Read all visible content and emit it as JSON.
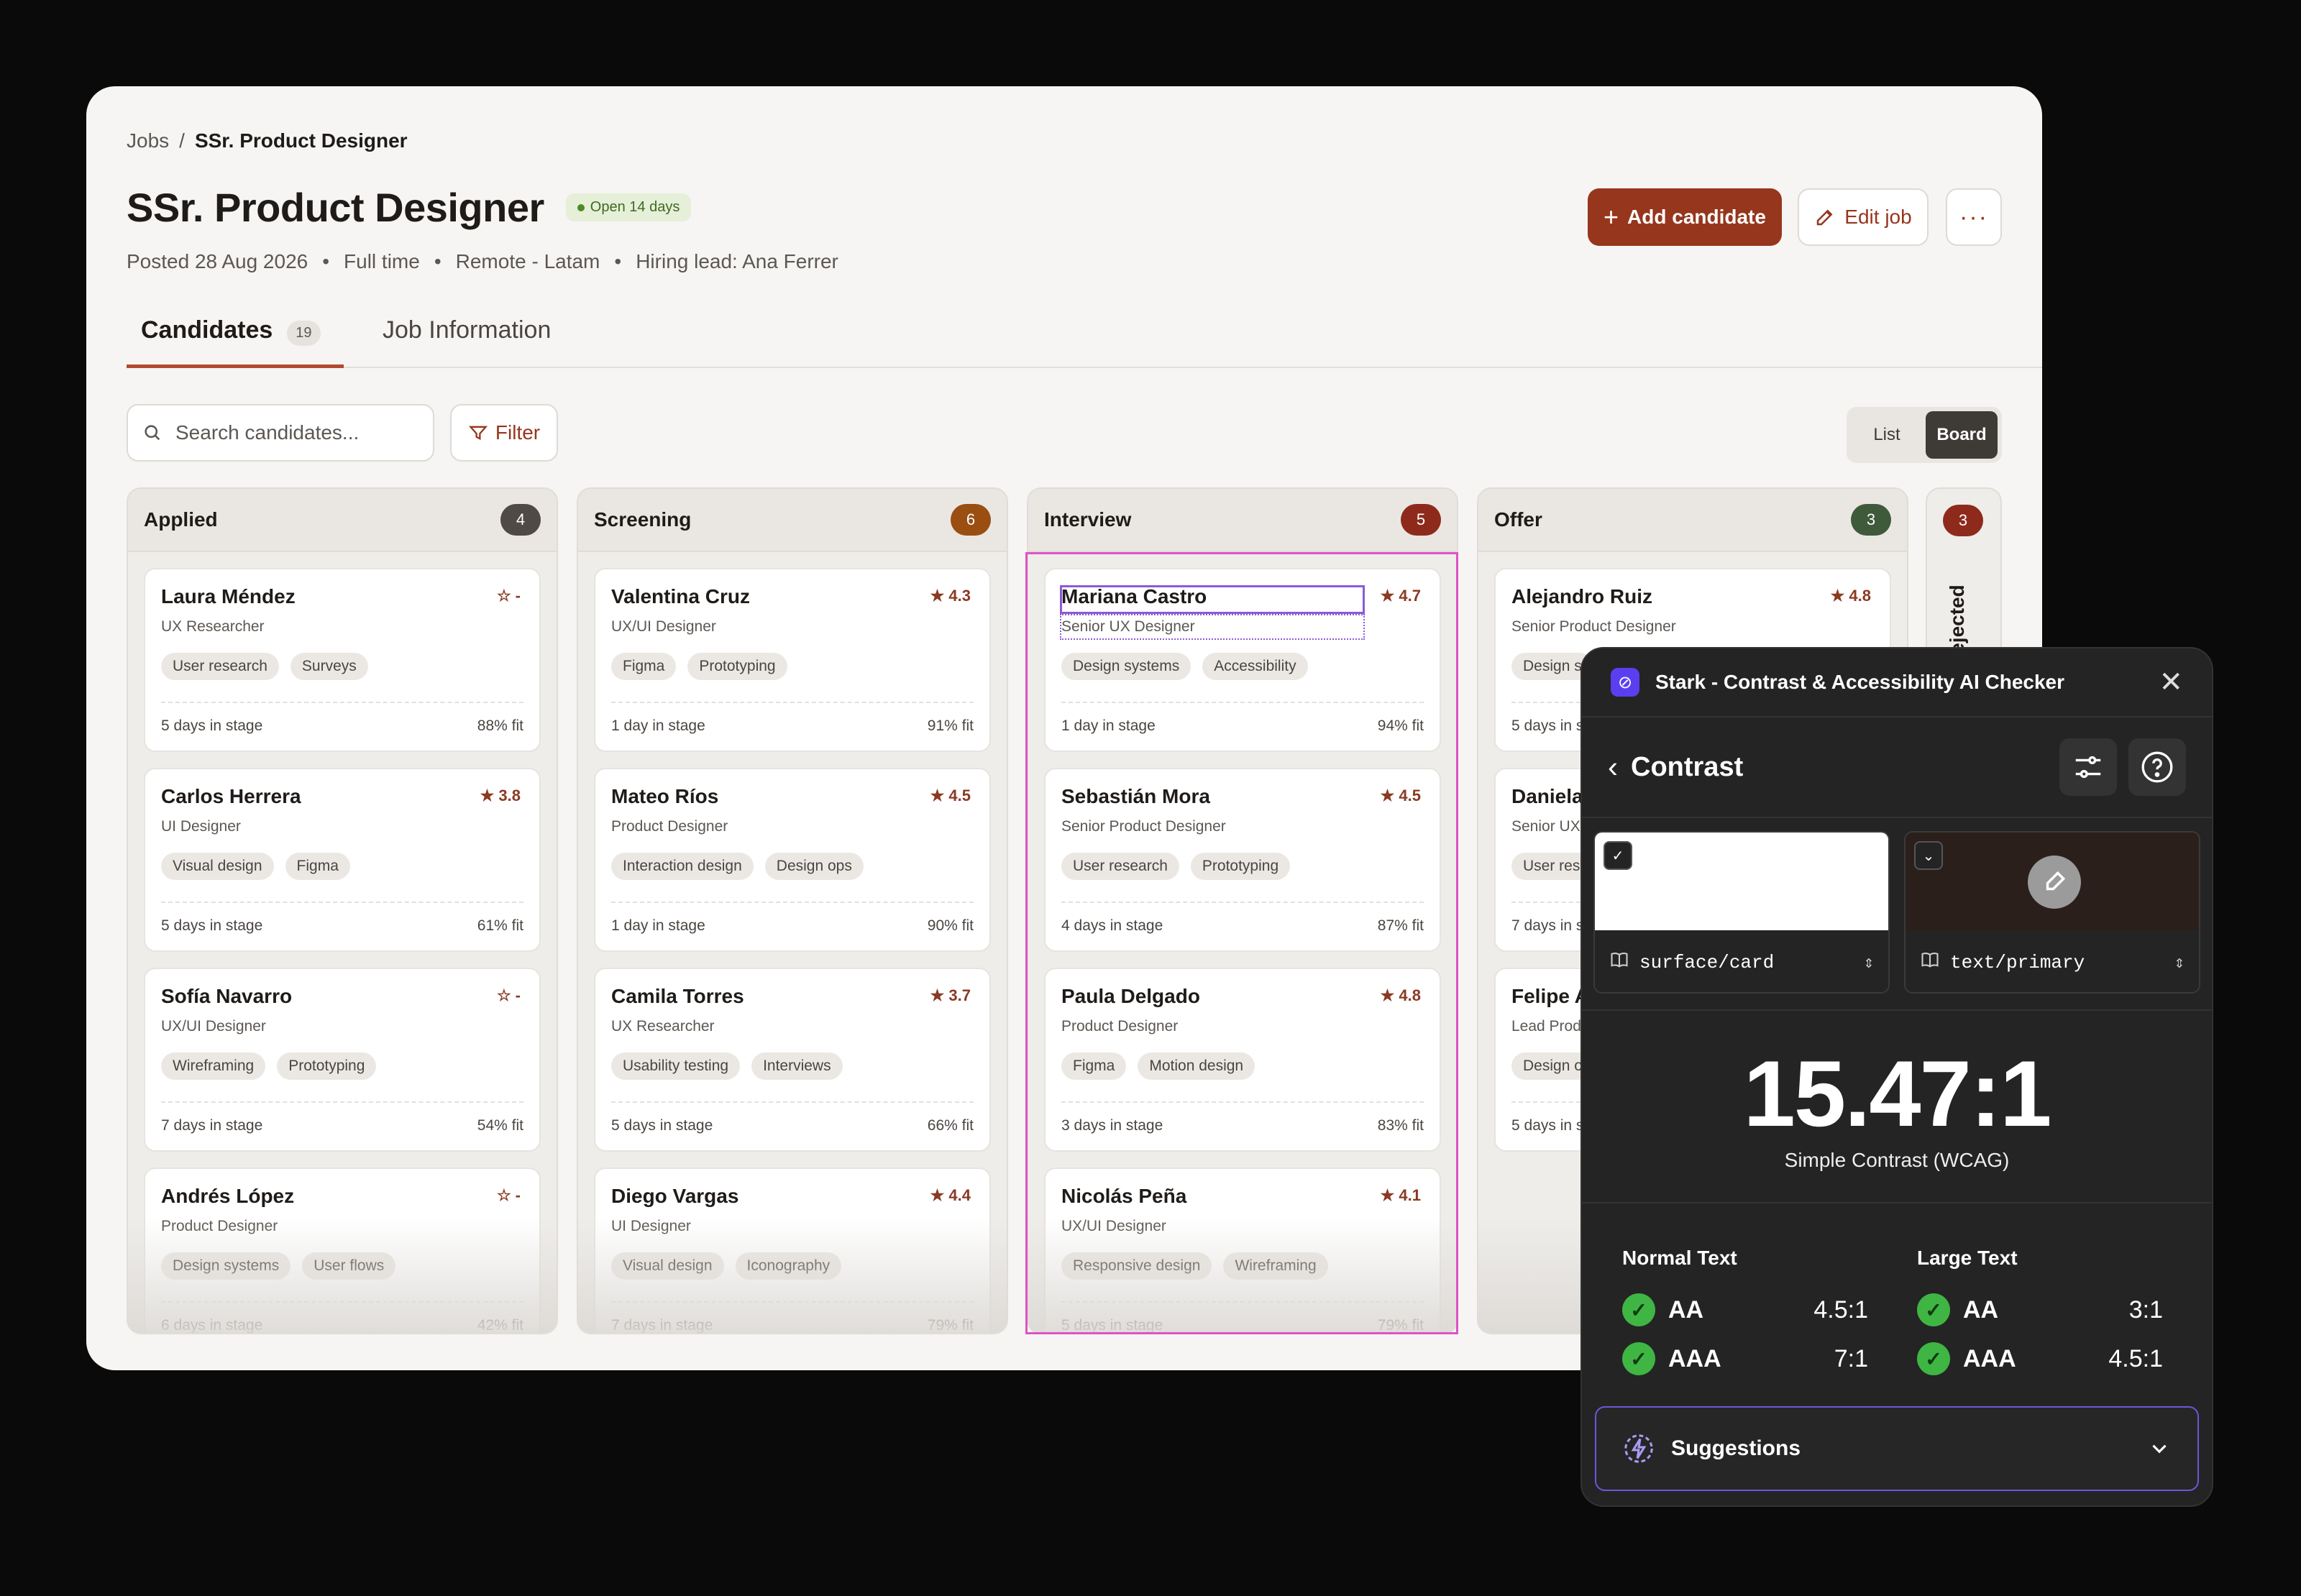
{
  "breadcrumb": {
    "root": "Jobs",
    "sep": "/",
    "current": "SSr. Product Designer"
  },
  "job": {
    "title": "SSr. Product Designer",
    "status": "Open 14 days",
    "posted": "Posted 28 Aug 2026",
    "type": "Full time",
    "location": "Remote - Latam",
    "lead": "Hiring lead: Ana Ferrer",
    "meta_sep": "•"
  },
  "actions": {
    "add": "Add candidate",
    "edit": "Edit job",
    "more": "···"
  },
  "tabs": [
    {
      "label": "Candidates",
      "count": "19"
    },
    {
      "label": "Job Information"
    }
  ],
  "search": {
    "placeholder": "Search candidates..."
  },
  "filter_label": "Filter",
  "view": {
    "list": "List",
    "board": "Board"
  },
  "columns": [
    {
      "title": "Applied",
      "count": "4",
      "color": "#4f4a45",
      "cards": [
        {
          "name": "Laura Méndez",
          "role": "UX Researcher",
          "rating": "-",
          "star": "☆",
          "tags": [
            "User research",
            "Surveys"
          ],
          "days": "5 days in stage",
          "fit": "88% fit"
        },
        {
          "name": "Carlos Herrera",
          "role": "UI Designer",
          "rating": "3.8",
          "star": "★",
          "tags": [
            "Visual design",
            "Figma"
          ],
          "days": "5 days in stage",
          "fit": "61% fit"
        },
        {
          "name": "Sofía Navarro",
          "role": "UX/UI Designer",
          "rating": "-",
          "star": "☆",
          "tags": [
            "Wireframing",
            "Prototyping"
          ],
          "days": "7 days in stage",
          "fit": "54% fit"
        },
        {
          "name": "Andrés López",
          "role": "Product Designer",
          "rating": "-",
          "star": "☆",
          "tags": [
            "Design systems",
            "User flows"
          ],
          "days": "6 days in stage",
          "fit": "42% fit"
        }
      ]
    },
    {
      "title": "Screening",
      "count": "6",
      "color": "#9a4e12",
      "cards": [
        {
          "name": "Valentina Cruz",
          "role": "UX/UI Designer",
          "rating": "4.3",
          "star": "★",
          "tags": [
            "Figma",
            "Prototyping"
          ],
          "days": "1 day in stage",
          "fit": "91% fit"
        },
        {
          "name": "Mateo Ríos",
          "role": "Product Designer",
          "rating": "4.5",
          "star": "★",
          "tags": [
            "Interaction design",
            "Design ops"
          ],
          "days": "1 day in stage",
          "fit": "90% fit"
        },
        {
          "name": "Camila Torres",
          "role": "UX Researcher",
          "rating": "3.7",
          "star": "★",
          "tags": [
            "Usability testing",
            "Interviews"
          ],
          "days": "5 days in stage",
          "fit": "66% fit"
        },
        {
          "name": "Diego Vargas",
          "role": "UI Designer",
          "rating": "4.4",
          "star": "★",
          "tags": [
            "Visual design",
            "Iconography"
          ],
          "days": "7 days in stage",
          "fit": "79% fit"
        }
      ]
    },
    {
      "title": "Interview",
      "count": "5",
      "color": "#8e2a1c",
      "cards": [
        {
          "name": "Mariana Castro",
          "role": "Senior UX Designer",
          "rating": "4.7",
          "star": "★",
          "tags": [
            "Design systems",
            "Accessibility"
          ],
          "days": "1 day in stage",
          "fit": "94% fit"
        },
        {
          "name": "Sebastián Mora",
          "role": "Senior Product Designer",
          "rating": "4.5",
          "star": "★",
          "tags": [
            "User research",
            "Prototyping"
          ],
          "days": "4 days in stage",
          "fit": "87% fit"
        },
        {
          "name": "Paula Delgado",
          "role": "Product Designer",
          "rating": "4.8",
          "star": "★",
          "tags": [
            "Figma",
            "Motion design"
          ],
          "days": "3 days in stage",
          "fit": "83% fit"
        },
        {
          "name": "Nicolás Peña",
          "role": "UX/UI Designer",
          "rating": "4.1",
          "star": "★",
          "tags": [
            "Responsive design",
            "Wireframing"
          ],
          "days": "5 days in stage",
          "fit": "79% fit"
        }
      ]
    },
    {
      "title": "Offer",
      "count": "3",
      "color": "#3f5a3a",
      "cards": [
        {
          "name": "Alejandro Ruiz",
          "role": "Senior Product Designer",
          "rating": "4.8",
          "star": "★",
          "tags": [
            "Design s"
          ],
          "days": "5 days in s",
          "fit": ""
        },
        {
          "name": "Daniela",
          "role": "Senior UX",
          "rating": "",
          "star": "",
          "tags": [
            "User rese"
          ],
          "days": "7 days in s",
          "fit": ""
        },
        {
          "name": "Felipe A",
          "role": "Lead Prod",
          "rating": "",
          "star": "",
          "tags": [
            "Design o"
          ],
          "days": "5 days in s",
          "fit": ""
        }
      ]
    }
  ],
  "rejected": {
    "title": "Rejected",
    "count": "3",
    "color": "#8e2a1c"
  },
  "stark": {
    "title": "Stark - Contrast & Accessibility AI Checker",
    "section": "Contrast",
    "bg_token": "surface/card",
    "fg_token": "text/primary",
    "bg_color": "#ffffff",
    "fg_color": "#2a1f1a",
    "ratio": "15.47:1",
    "ratio_label": "Simple Contrast (WCAG)",
    "normal": {
      "title": "Normal Text",
      "aa": "AA",
      "aa_val": "4.5:1",
      "aaa": "AAA",
      "aaa_val": "7:1"
    },
    "large": {
      "title": "Large Text",
      "aa": "AA",
      "aa_val": "3:1",
      "aaa": "AAA",
      "aaa_val": "4.5:1"
    },
    "suggestions": "Suggestions"
  }
}
